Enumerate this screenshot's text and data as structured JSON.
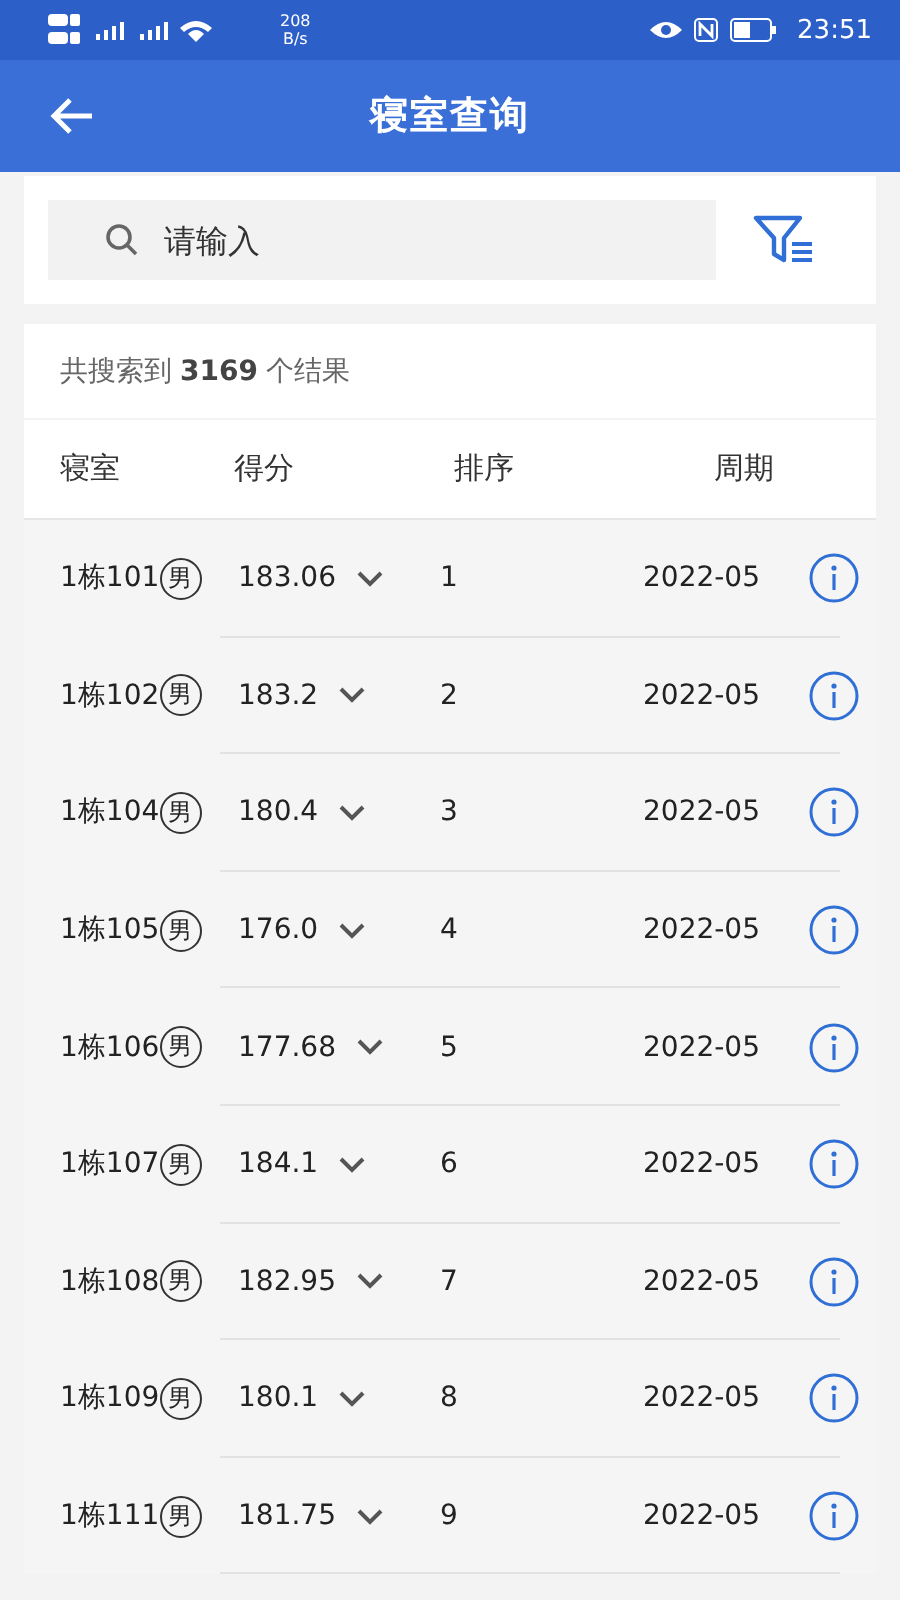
{
  "status_bar": {
    "net_speed": "208",
    "net_unit": "B/s",
    "time": "23:51"
  },
  "header": {
    "title": "寝室查询"
  },
  "search": {
    "placeholder": "请输入"
  },
  "summary": "共搜索到 **3169** 个结果",
  "table": {
    "columns": [
      "寝室",
      "得分",
      "排序",
      "周期"
    ],
    "rows": [
      {
        "room": "1栋101",
        "gender": "男",
        "score": "183.06",
        "rank": "1",
        "period": "2022-05"
      },
      {
        "room": "1栋102",
        "gender": "男",
        "score": "183.2",
        "rank": "2",
        "period": "2022-05"
      },
      {
        "room": "1栋104",
        "gender": "男",
        "score": "180.4",
        "rank": "3",
        "period": "2022-05"
      },
      {
        "room": "1栋105",
        "gender": "男",
        "score": "176.0",
        "rank": "4",
        "period": "2022-05"
      },
      {
        "room": "1栋106",
        "gender": "男",
        "score": "177.68",
        "rank": "5",
        "period": "2022-05"
      },
      {
        "room": "1栋107",
        "gender": "男",
        "score": "184.1",
        "rank": "6",
        "period": "2022-05"
      },
      {
        "room": "1栋108",
        "gender": "男",
        "score": "182.95",
        "rank": "7",
        "period": "2022-05"
      },
      {
        "room": "1栋109",
        "gender": "男",
        "score": "180.1",
        "rank": "8",
        "period": "2022-05"
      },
      {
        "room": "1栋111",
        "gender": "男",
        "score": "181.75",
        "rank": "9",
        "period": "2022-05"
      }
    ]
  }
}
